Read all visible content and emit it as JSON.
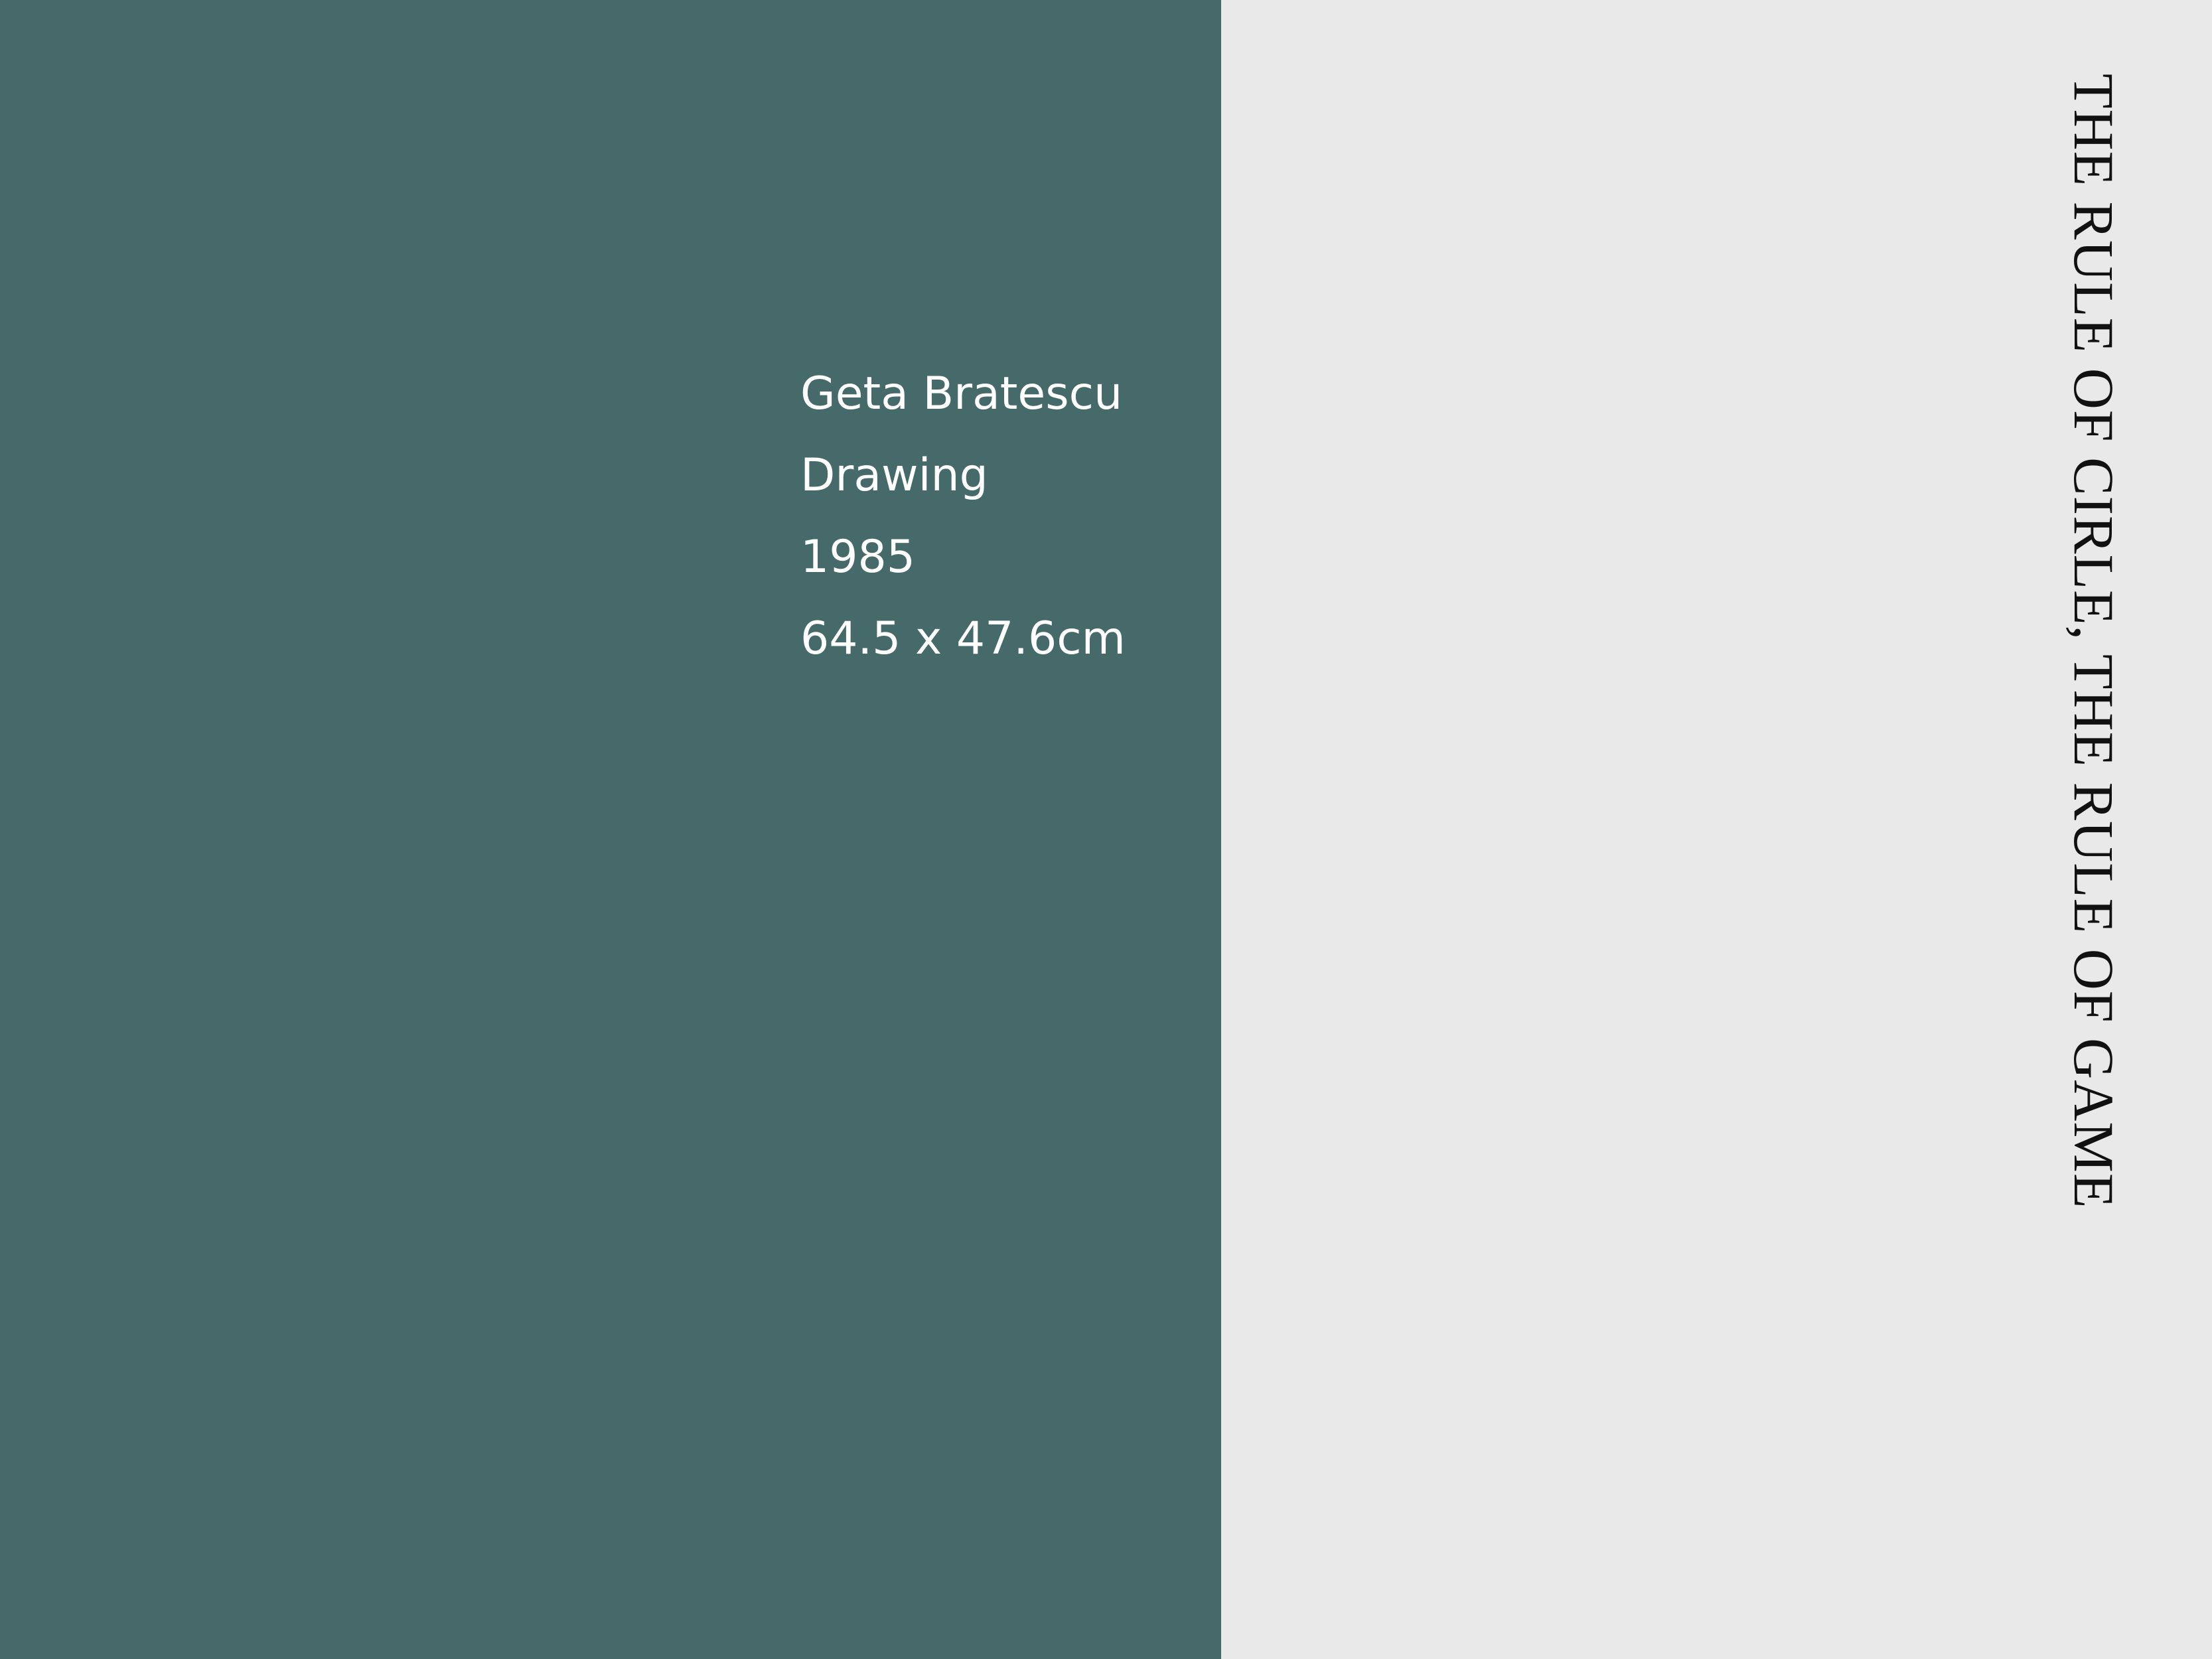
{
  "artwork": {
    "artist": "Geta Bratescu",
    "medium": "Drawing",
    "year": "1985",
    "dimensions": "64.5 x 47.6cm"
  },
  "title": {
    "vertical_text": "THE RULE OF CIRLE, THE RULE OF GAME"
  },
  "colors": {
    "left_panel": "#456a69",
    "right_panel": "#e9e9e9",
    "info_text": "#ffffff",
    "title_text": "#111111"
  }
}
